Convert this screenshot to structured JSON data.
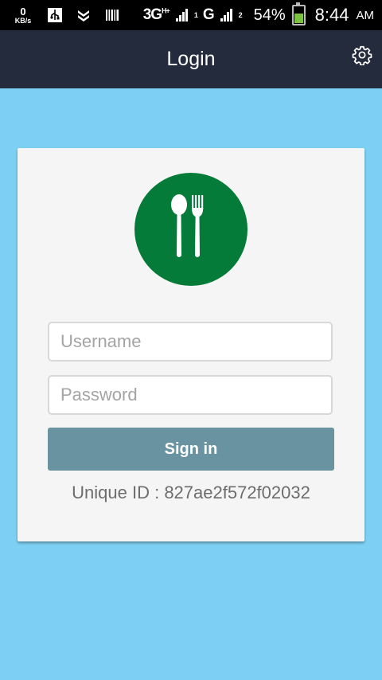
{
  "status_bar": {
    "speed_value": "0",
    "speed_unit": "KB/s",
    "network_1": "3G",
    "network_1_sup": "H+",
    "network_1_sub": "1",
    "network_2": "G",
    "network_2_sup": "2",
    "battery_percent": "54%",
    "time": "8:44",
    "ampm": "AM",
    "icons": [
      "usb-icon",
      "download-icon",
      "barcode-icon",
      "signal-icon",
      "battery-icon"
    ]
  },
  "app_bar": {
    "title": "Login",
    "settings_icon": "gear-icon"
  },
  "login": {
    "logo_icon": "spoon-fork-icon",
    "username_placeholder": "Username",
    "password_placeholder": "Password",
    "sign_in_label": "Sign in",
    "unique_id": "Unique ID : 827ae2f572f02032"
  },
  "colors": {
    "background": "#7dd0f3",
    "app_bar": "#242b3d",
    "logo": "#057b3a",
    "button": "#6a93a1",
    "card": "#f5f5f5"
  }
}
